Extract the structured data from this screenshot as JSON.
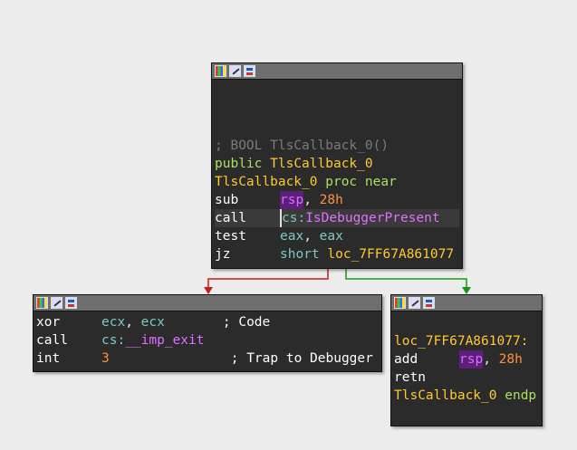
{
  "colors": {
    "red_edge": "#cc1a1a",
    "green_edge": "#189618"
  },
  "top_node": {
    "lines": [
      {
        "comment": "; BOOL TlsCallback_0()"
      },
      {
        "kw1": "public",
        "sym": "TlsCallback_0"
      },
      {
        "sym": "TlsCallback_0",
        "kw1": "proc",
        "kw2": "near"
      },
      {
        "mnemonic": "sub",
        "op1": "rsp",
        "sep": ", ",
        "op2": "28h"
      },
      {
        "mnemonic": "call",
        "op1": "cs:",
        "op2": "IsDebuggerPresent"
      },
      {
        "mnemonic": "test",
        "op1": "eax",
        "sep": ", ",
        "op2": "eax"
      },
      {
        "mnemonic": "jz",
        "op1": "short",
        "op2": "loc_7FF67A861077"
      }
    ]
  },
  "left_node": {
    "lines": [
      {
        "mnemonic": "xor",
        "op1": "ecx",
        "sep": ", ",
        "op2": "ecx",
        "comment": "; Code"
      },
      {
        "mnemonic": "call",
        "op1": "cs:",
        "op2": "__imp_exit"
      },
      {
        "mnemonic": "int",
        "op1": "3",
        "comment": "; Trap to Debugger"
      }
    ]
  },
  "right_node": {
    "lines": [
      {
        "label": "loc_7FF67A861077:"
      },
      {
        "mnemonic": "add",
        "op1": "rsp",
        "sep": ", ",
        "op2": "28h"
      },
      {
        "mnemonic": "retn"
      },
      {
        "sym": "TlsCallback_0",
        "kw1": "endp"
      }
    ]
  }
}
